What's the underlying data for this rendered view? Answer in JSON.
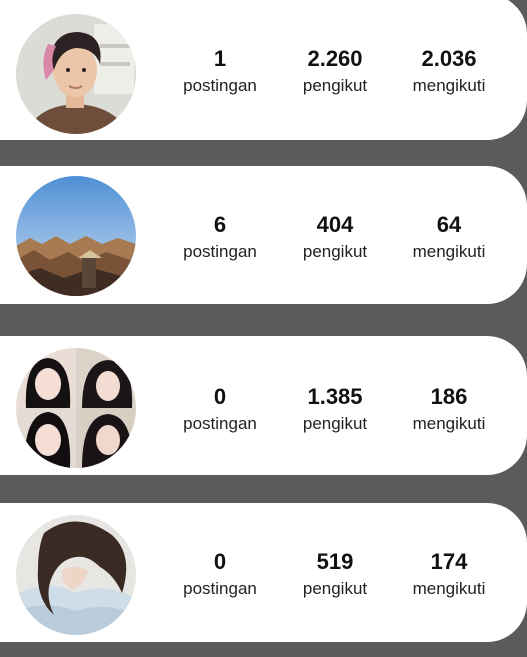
{
  "profiles": [
    {
      "avatar_icon": "profile-photo-man-pink-hair",
      "posts": "1",
      "posts_label": "postingan",
      "followers": "2.260",
      "followers_label": "pengikut",
      "following": "2.036",
      "following_label": "mengikuti"
    },
    {
      "avatar_icon": "profile-photo-rooftops-sky",
      "posts": "6",
      "posts_label": "postingan",
      "followers": "404",
      "followers_label": "pengikut",
      "following": "64",
      "following_label": "mengikuti"
    },
    {
      "avatar_icon": "profile-photo-woman-collage",
      "posts": "0",
      "posts_label": "postingan",
      "followers": "1.385",
      "followers_label": "pengikut",
      "following": "186",
      "following_label": "mengikuti"
    },
    {
      "avatar_icon": "profile-photo-woman-long-hair",
      "posts": "0",
      "posts_label": "postingan",
      "followers": "519",
      "followers_label": "pengikut",
      "following": "174",
      "following_label": "mengikuti"
    }
  ]
}
